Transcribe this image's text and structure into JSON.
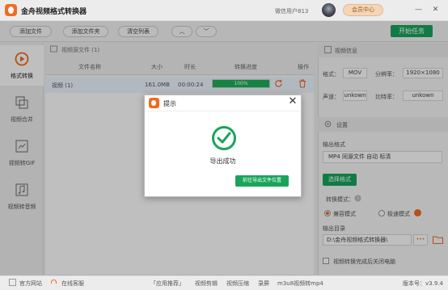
{
  "app": {
    "title": "金舟视频格式转换器",
    "user_name": "微信用户813",
    "vip_label": "会员中心",
    "minimize": "—",
    "close": "✕"
  },
  "toolbar": {
    "add_file": "添加文件",
    "add_folder": "添加文件夹",
    "clear_list": "清空列表",
    "up": "︿",
    "down": "﹀",
    "start_task": "开始任务"
  },
  "sidebar": {
    "items": [
      {
        "label": "格式转换",
        "icon": "play-circle-icon",
        "active": true
      },
      {
        "label": "视频合并",
        "icon": "merge-icon",
        "active": false
      },
      {
        "label": "视频转GIF",
        "icon": "gif-icon",
        "active": false
      },
      {
        "label": "视频转音频",
        "icon": "music-icon",
        "active": false
      }
    ]
  },
  "file_list": {
    "section_title": "视频源文件 (1)",
    "columns": [
      "文件名称",
      "大小",
      "时长",
      "转换进度",
      "操作"
    ],
    "rows": [
      {
        "name": "视频 (1)",
        "size": "161.0MB",
        "duration": "00:00:24",
        "progress": "100%",
        "progress_value": 1.0
      }
    ]
  },
  "video_info": {
    "title": "视频信息",
    "format_label": "格式：",
    "format_value": "MOV",
    "resolution_label": "分辨率：",
    "resolution_value": "1920×1080",
    "channel_label": "声道：",
    "channel_value": "unkown",
    "bitrate_label": "比特率：",
    "bitrate_value": "unkown"
  },
  "settings": {
    "title": "设置",
    "output_format_label": "输出格式",
    "output_format_value": "MP4 同源文件 自动 标清",
    "select_format_button": "选择格式",
    "convert_mode_label": "转换模式：",
    "mode_compatible": "兼容模式",
    "mode_fast": "极速模式",
    "output_dir_label": "输出目录",
    "output_dir_value": "D:\\金舟视频格式转换器\\",
    "more": "•••",
    "shutdown_label": "视频转换完成后关闭电脑"
  },
  "statusbar": {
    "website": "官方网站",
    "support": "在线客服",
    "recommend": "「应用推荐」",
    "editor": "视频剪辑",
    "compress": "视频压缩",
    "record": "录屏",
    "m3u8": "m3u8视频转mp4",
    "version": "版本号：v3.9.4"
  },
  "dialog": {
    "title": "提示",
    "close": "✕",
    "message": "导出成功",
    "button": "前往导出文件位置"
  },
  "colors": {
    "accent_green": "#19a45c",
    "brand_orange": "#f26b21"
  }
}
